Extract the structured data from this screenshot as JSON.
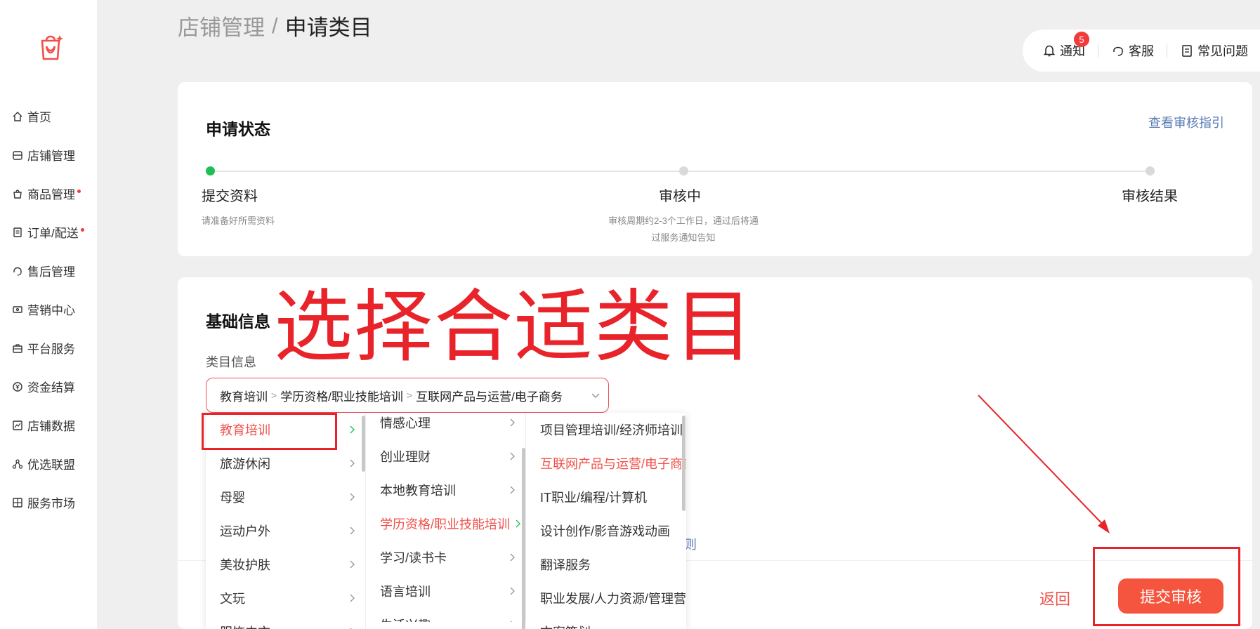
{
  "sidebar": {
    "items": [
      {
        "label": "首页",
        "icon": "home-icon",
        "dot": false
      },
      {
        "label": "店铺管理",
        "icon": "store-icon",
        "dot": false
      },
      {
        "label": "商品管理",
        "icon": "bag-icon",
        "dot": true
      },
      {
        "label": "订单/配送",
        "icon": "order-icon",
        "dot": true
      },
      {
        "label": "售后管理",
        "icon": "headset-icon",
        "dot": false
      },
      {
        "label": "营销中心",
        "icon": "ticket-icon",
        "dot": false
      },
      {
        "label": "平台服务",
        "icon": "briefcase-icon",
        "dot": false
      },
      {
        "label": "资金结算",
        "icon": "yen-icon",
        "dot": false
      },
      {
        "label": "店铺数据",
        "icon": "chart-icon",
        "dot": false
      },
      {
        "label": "优选联盟",
        "icon": "network-icon",
        "dot": false
      },
      {
        "label": "服务市场",
        "icon": "market-icon",
        "dot": false
      }
    ]
  },
  "header": {
    "breadcrumb_parent": "店铺管理",
    "breadcrumb_sep": "/",
    "breadcrumb_current": "申请类目"
  },
  "topbar": {
    "notify_label": "通知",
    "notify_count": "5",
    "service_label": "客服",
    "faq_label": "常见问题"
  },
  "status": {
    "title": "申请状态",
    "guide_link": "查看审核指引",
    "steps": [
      {
        "label": "提交资料",
        "desc": "请准备好所需资料",
        "active": true
      },
      {
        "label": "审核中",
        "desc_line1": "审核周期约2-3个工作日，通过后将通",
        "desc_line2": "过服务通知告知",
        "active": false
      },
      {
        "label": "审核结果",
        "active": false
      }
    ]
  },
  "basic": {
    "title": "基础信息",
    "overlay_text": "选择合适类目",
    "field_label": "类目信息",
    "selected_path": [
      "教育培训",
      "学历资格/职业技能培训",
      "互联网产品与运营/电子商务"
    ],
    "path_sep": ">",
    "rules_tail": "则"
  },
  "dropdown": {
    "col1": [
      {
        "label": "教育培训",
        "selected": true
      },
      {
        "label": "旅游休闲",
        "selected": false
      },
      {
        "label": "母婴",
        "selected": false
      },
      {
        "label": "运动户外",
        "selected": false
      },
      {
        "label": "美妆护肤",
        "selected": false
      },
      {
        "label": "文玩",
        "selected": false
      },
      {
        "label": "服饰内衣",
        "selected": false
      }
    ],
    "col2": [
      {
        "label": "情感心理",
        "selected": false
      },
      {
        "label": "创业理财",
        "selected": false
      },
      {
        "label": "本地教育培训",
        "selected": false
      },
      {
        "label": "学历资格/职业技能培训",
        "selected": true
      },
      {
        "label": "学习/读书卡",
        "selected": false
      },
      {
        "label": "语言培训",
        "selected": false
      },
      {
        "label": "生活兴趣",
        "selected": false
      }
    ],
    "col3": [
      {
        "label": "项目管理培训/经济师培训",
        "selected": false
      },
      {
        "label": "互联网产品与运营/电子商务",
        "selected": true
      },
      {
        "label": "IT职业/编程/计算机",
        "selected": false
      },
      {
        "label": "设计创作/影音游戏动画",
        "selected": false
      },
      {
        "label": "翻译服务",
        "selected": false
      },
      {
        "label": "职业发展/人力资源/管理营销",
        "selected": false
      },
      {
        "label": "文案策划",
        "selected": false
      }
    ]
  },
  "footer": {
    "back_label": "返回",
    "submit_label": "提交审核"
  },
  "colors": {
    "accent": "#f5553e",
    "annotation_red": "#e8232a",
    "active_step": "#1fbf55",
    "link": "#5a7bb5"
  }
}
